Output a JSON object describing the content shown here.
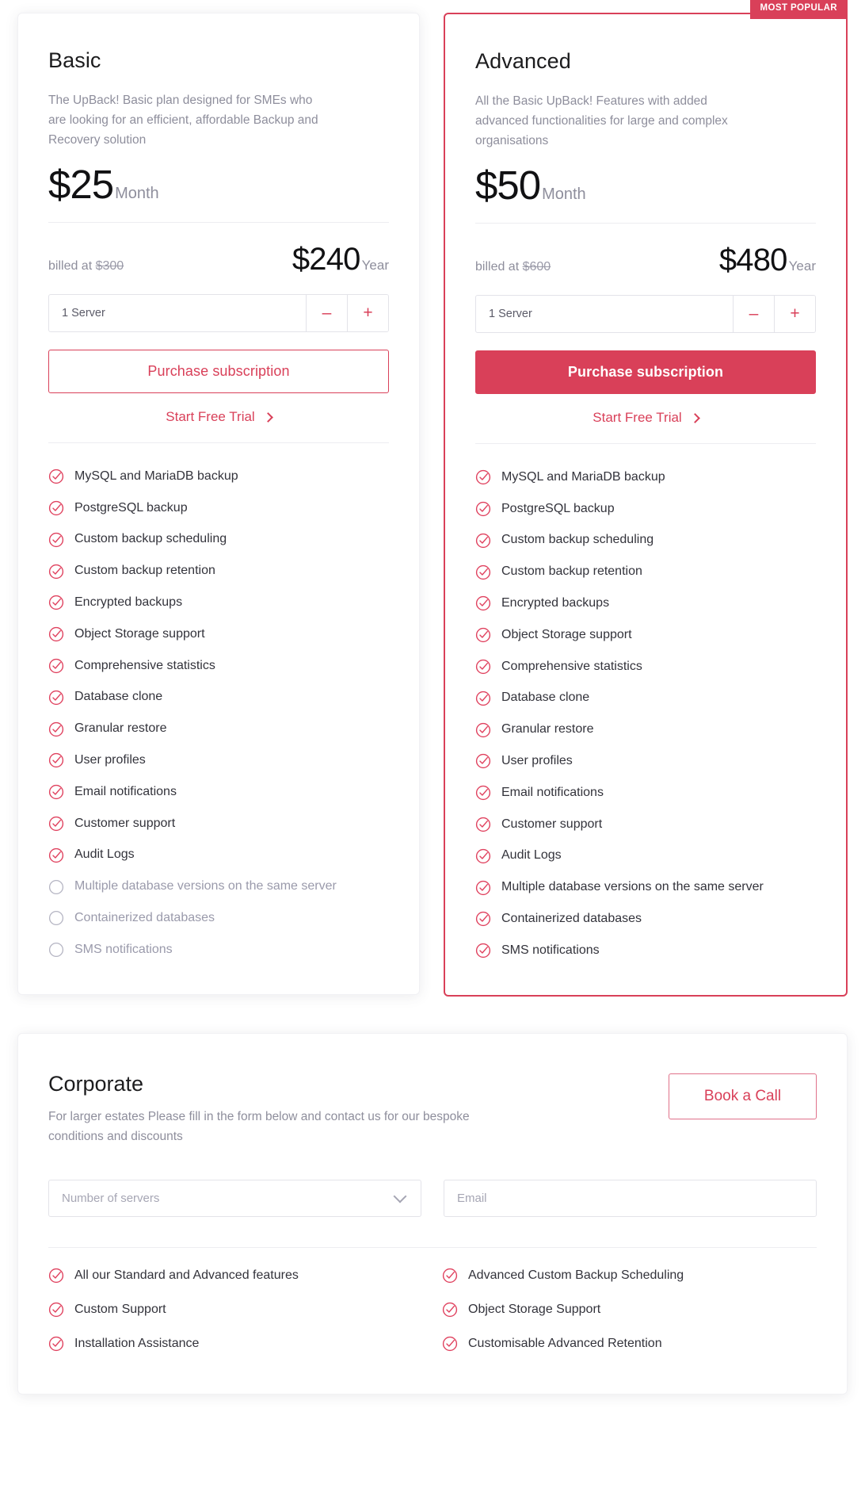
{
  "plans": [
    {
      "name": "Basic",
      "description": "The UpBack! Basic plan designed for SMEs who are looking for an efficient, affordable Backup and Recovery solution",
      "month_amount": "$25",
      "month_period": "Month",
      "billed_label": "billed at",
      "billed_strike": "$300",
      "year_amount": "$240",
      "year_period": "Year",
      "quantity_value": "1 Server",
      "decrement_label": "–",
      "increment_label": "+",
      "purchase_label": "Purchase subscription",
      "trial_label": "Start Free Trial",
      "badge": "",
      "features": [
        {
          "label": "MySQL and MariaDB backup",
          "included": true
        },
        {
          "label": "PostgreSQL backup",
          "included": true
        },
        {
          "label": "Custom backup scheduling",
          "included": true
        },
        {
          "label": "Custom backup retention",
          "included": true
        },
        {
          "label": "Encrypted backups",
          "included": true
        },
        {
          "label": "Object Storage support",
          "included": true
        },
        {
          "label": "Comprehensive statistics",
          "included": true
        },
        {
          "label": "Database clone",
          "included": true
        },
        {
          "label": "Granular restore",
          "included": true
        },
        {
          "label": "User profiles",
          "included": true
        },
        {
          "label": "Email notifications",
          "included": true
        },
        {
          "label": "Customer support",
          "included": true
        },
        {
          "label": "Audit Logs",
          "included": true
        },
        {
          "label": "Multiple database versions on the same server",
          "included": false
        },
        {
          "label": "Containerized databases",
          "included": false
        },
        {
          "label": "SMS notifications",
          "included": false
        }
      ]
    },
    {
      "name": "Advanced",
      "description": "All the Basic UpBack! Features with added advanced functionalities for large and complex organisations",
      "month_amount": "$50",
      "month_period": "Month",
      "billed_label": "billed at",
      "billed_strike": "$600",
      "year_amount": "$480",
      "year_period": "Year",
      "quantity_value": "1 Server",
      "decrement_label": "–",
      "increment_label": "+",
      "purchase_label": "Purchase subscription",
      "trial_label": "Start Free Trial",
      "badge": "MOST POPULAR",
      "features": [
        {
          "label": "MySQL and MariaDB backup",
          "included": true
        },
        {
          "label": "PostgreSQL backup",
          "included": true
        },
        {
          "label": "Custom backup scheduling",
          "included": true
        },
        {
          "label": "Custom backup retention",
          "included": true
        },
        {
          "label": "Encrypted backups",
          "included": true
        },
        {
          "label": "Object Storage support",
          "included": true
        },
        {
          "label": "Comprehensive statistics",
          "included": true
        },
        {
          "label": "Database clone",
          "included": true
        },
        {
          "label": "Granular restore",
          "included": true
        },
        {
          "label": "User profiles",
          "included": true
        },
        {
          "label": "Email notifications",
          "included": true
        },
        {
          "label": "Customer support",
          "included": true
        },
        {
          "label": "Audit Logs",
          "included": true
        },
        {
          "label": "Multiple database versions on the same server",
          "included": true
        },
        {
          "label": "Containerized databases",
          "included": true
        },
        {
          "label": "SMS notifications",
          "included": true
        }
      ]
    }
  ],
  "corporate": {
    "title": "Corporate",
    "description": "For larger estates Please fill in the form below and contact us for our bespoke conditions and discounts",
    "book_label": "Book a Call",
    "servers_placeholder": "Number of servers",
    "email_placeholder": "Email",
    "features_left": [
      "All our Standard and Advanced features",
      "Custom Support",
      "Installation Assistance"
    ],
    "features_right": [
      "Advanced Custom Backup Scheduling",
      "Object Storage Support",
      "Customisable Advanced Retention"
    ]
  },
  "colors": {
    "accent": "#d94059",
    "muted": "#8e8e9c",
    "text": "#1c1c1e",
    "border": "#e3e3e9"
  }
}
